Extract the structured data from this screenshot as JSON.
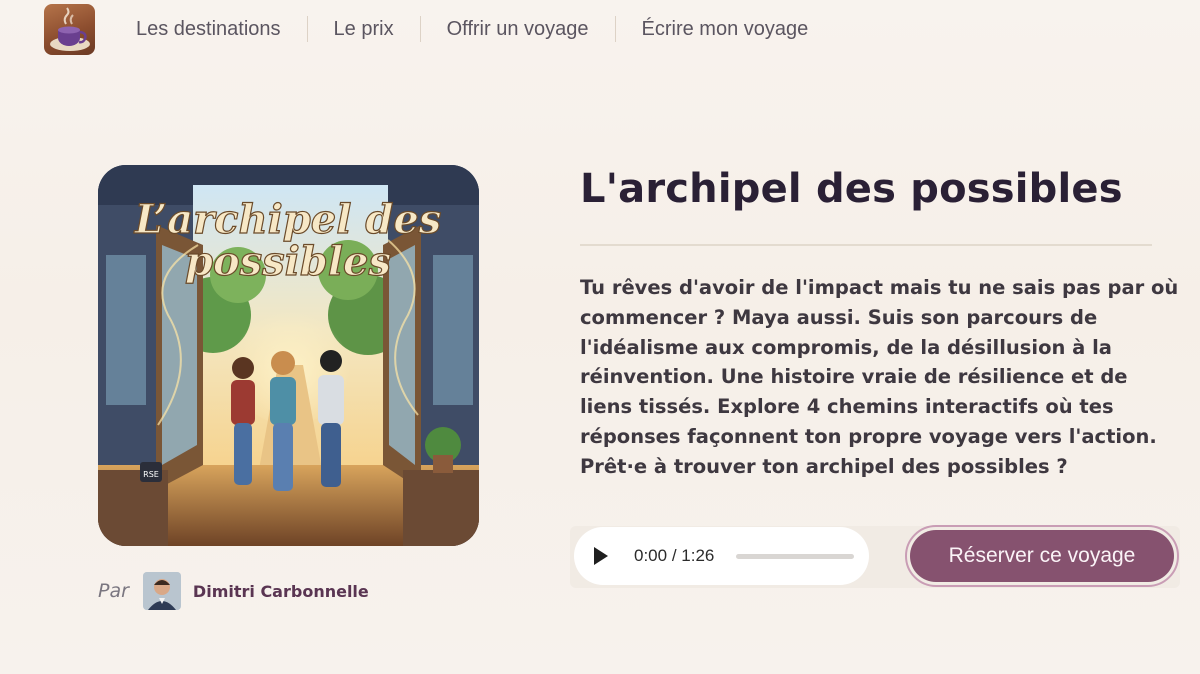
{
  "nav": {
    "links": [
      "Les destinations",
      "Le prix",
      "Offrir un voyage",
      "Écrire mon voyage"
    ],
    "logo_icon": "coffee-cup-icon"
  },
  "cover": {
    "title_line1": "L’archipel des",
    "title_line2": "possibles",
    "mug_text": "RSE"
  },
  "author": {
    "prefix": "Par",
    "name": "Dimitri Carbonnelle"
  },
  "story": {
    "title": "L'archipel des possibles",
    "description": "Tu rêves d'avoir de l'impact mais tu ne sais pas par où commencer ? Maya aussi. Suis son parcours de l'idéalisme aux compromis, de la désillusion à la réinvention. Une histoire vraie de résilience et de liens tissés. Explore 4 chemins interactifs où tes réponses façonnent ton propre voyage vers l'action. Prêt·e à trouver ton archipel des possibles ?"
  },
  "audio": {
    "current": "0:00",
    "separator": " / ",
    "duration": "1:26",
    "progress": 0
  },
  "cta": {
    "reserve_label": "Réserver ce voyage"
  },
  "colors": {
    "accent": "#86526f",
    "author_name": "#5a3552",
    "background": "#f7f1eb"
  }
}
